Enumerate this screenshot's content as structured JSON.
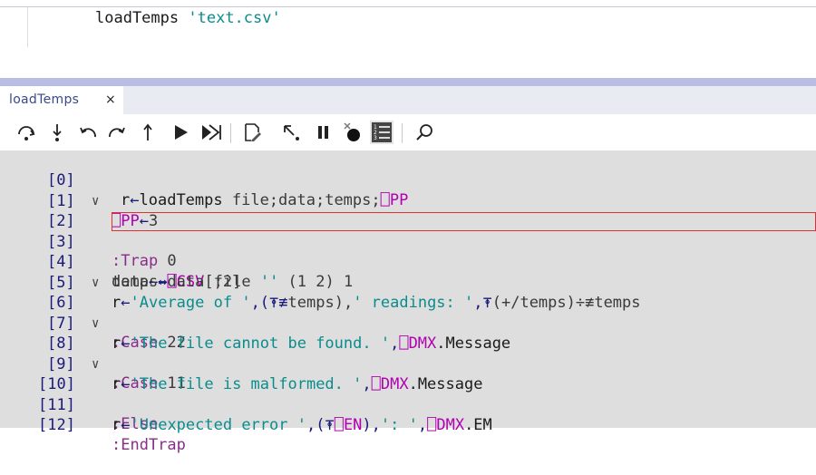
{
  "session": {
    "command_fn": "loadTemps",
    "command_arg": "'text.csv'"
  },
  "tab": {
    "label": "loadTemps",
    "close": "×"
  },
  "toolbar": {
    "icons": [
      "step-over-icon",
      "step-into-icon",
      "step-back-icon",
      "step-forward-icon",
      "step-out-icon",
      "run-icon",
      "run-to-end-icon",
      "edit-icon",
      "cursor-icon",
      "pause-icon",
      "clear-stops-icon",
      "line-numbers-icon",
      "search-icon"
    ]
  },
  "editor": {
    "line_numbers": [
      "[0]",
      "[1]",
      "[2]",
      "[3]",
      "[4]",
      "[5]",
      "[6]",
      "[7]",
      "[8]",
      "[9]",
      "[10]",
      "[11]",
      "[12]"
    ],
    "fold_marker": "∨",
    "lines": {
      "l0": {
        "a": "r",
        "b": "←",
        "c": "loadTemps",
        "d": " file;data;temps;",
        "e": "⎕PP"
      },
      "l1": {
        "a": "⎕PP",
        "b": "←",
        "c": "3"
      },
      "l2": {
        "a": ":Trap",
        "b": " 0"
      },
      "l3": {
        "a": "data",
        "b": "←",
        "c": "⇒",
        "d": "⎕CSV",
        "e": " file ",
        "f": "''",
        "g": " (1 2) 1"
      },
      "l4": {
        "a": "temps",
        "b": "←",
        "c": "data[;2]"
      },
      "l5": {
        "a": "r",
        "b": "←",
        "c": "'Average of '",
        "d": ",(",
        "e": "⍕≢",
        "f": "temps),",
        "g": "' readings: '",
        "h": ",",
        "i": "⍕",
        "j": "(+/temps)÷≢temps"
      },
      "l6": {
        "a": ":Case",
        "b": " 22"
      },
      "l7": {
        "a": "r",
        "b": "←",
        "c": "'The file cannot be found. '",
        "d": ",",
        "e": "⎕DMX",
        "f": ".Message"
      },
      "l8": {
        "a": ":Case",
        "b": " 11"
      },
      "l9": {
        "a": "r",
        "b": "←",
        "c": "'The file is malformed. '",
        "d": ",",
        "e": "⎕DMX",
        "f": ".Message"
      },
      "l10": {
        "a": ":Else"
      },
      "l11": {
        "a": "r",
        "b": "←",
        "c": "'Unexpected error '",
        "d": ",(",
        "e": "⍕",
        "f": "⎕EN",
        "g": "),",
        "h": "': '",
        "i": ",",
        "j": "⎕DMX",
        "k": ".EM"
      },
      "l12": {
        "a": ":EndTrap"
      }
    }
  },
  "colors": {
    "editor_bg": "#dedede",
    "current_line_border": "#e03030",
    "keyword": "#8a2c8a",
    "system_name": "#b000b0",
    "string": "#0b8c8c",
    "line_number": "#1a1a7a"
  }
}
